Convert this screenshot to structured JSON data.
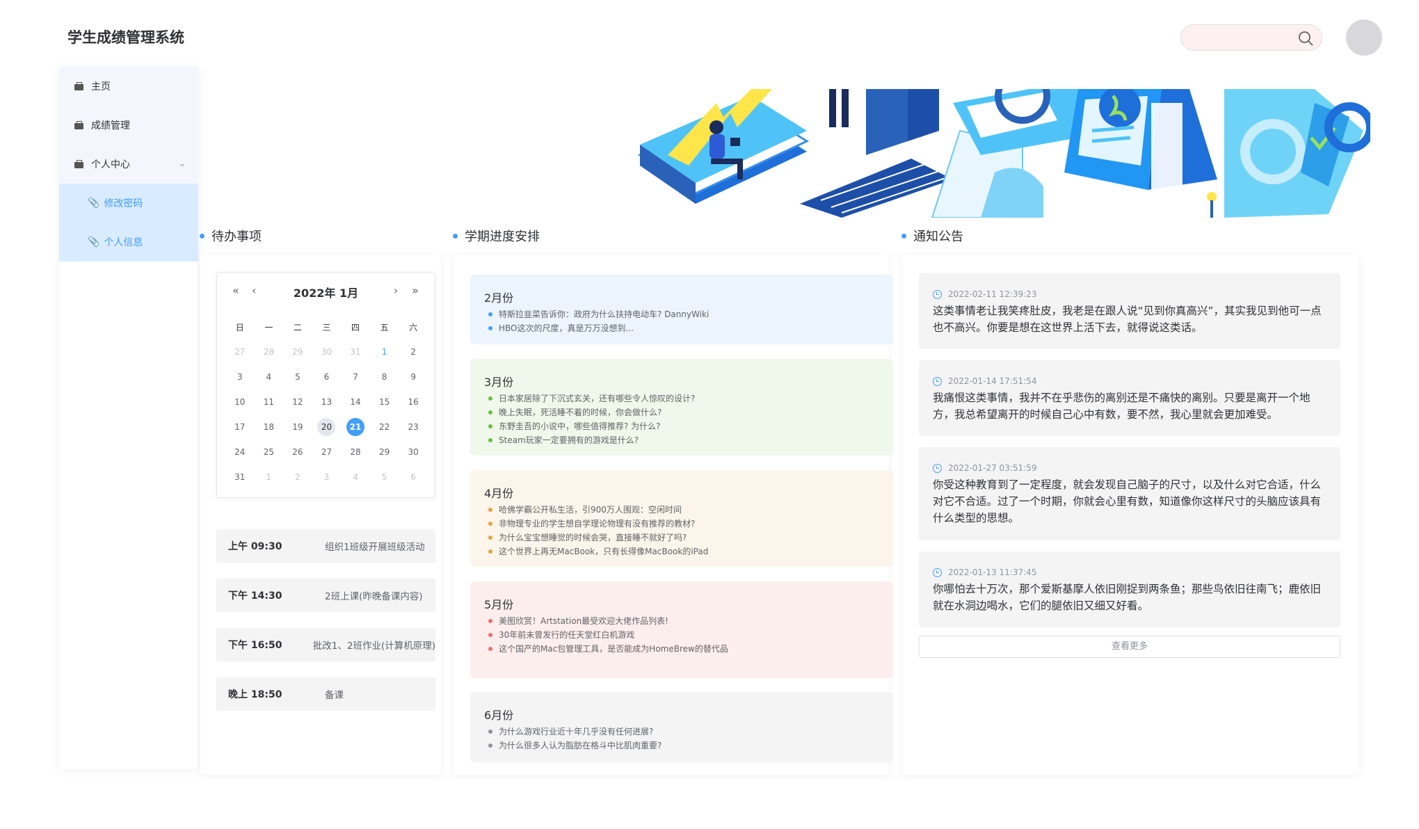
{
  "header": {
    "app_title": "学生成绩管理系统",
    "search_placeholder": ""
  },
  "sidebar": {
    "items": [
      {
        "label": "主页"
      },
      {
        "label": "成绩管理"
      },
      {
        "label": "个人中心"
      }
    ],
    "sub_items": [
      {
        "label": "修改密码"
      },
      {
        "label": "个人信息"
      }
    ]
  },
  "sections": {
    "todo_title": "待办事项",
    "semester_title": "学期进度安排",
    "notice_title": "通知公告"
  },
  "calendar": {
    "title": "2022年  1月",
    "nav": {
      "prev_year": "«",
      "prev_month": "‹",
      "next_month": "›",
      "next_year": "»"
    },
    "weekdays": [
      "日",
      "一",
      "二",
      "三",
      "四",
      "五",
      "六"
    ],
    "weeks": [
      [
        "27",
        "28",
        "29",
        "30",
        "31",
        "1",
        "2"
      ],
      [
        "3",
        "4",
        "5",
        "6",
        "7",
        "8",
        "9"
      ],
      [
        "10",
        "11",
        "12",
        "13",
        "14",
        "15",
        "16"
      ],
      [
        "17",
        "18",
        "19",
        "20",
        "21",
        "22",
        "23"
      ],
      [
        "24",
        "25",
        "26",
        "27",
        "28",
        "29",
        "30"
      ],
      [
        "31",
        "1",
        "2",
        "3",
        "4",
        "5",
        "6"
      ]
    ],
    "today": "20",
    "selected": "21"
  },
  "todos": [
    {
      "time": "上午 09:30",
      "text": "组织1班级开展班级活动"
    },
    {
      "time": "下午 14:30",
      "text": "2班上课(昨晚备课内容)"
    },
    {
      "time": "下午 16:50",
      "text": "批改1、2班作业(计算机原理)"
    },
    {
      "time": "晚上 18:50",
      "text": "备课"
    }
  ],
  "semester": [
    {
      "month": "2月份",
      "bg": "#ecf4fe",
      "dot": "#409eff",
      "items": [
        "特斯拉韭菜告诉你：政府为什么扶持电动车? DannyWiki",
        "HBO这次的尺度，真是万万没想到..."
      ]
    },
    {
      "month": "3月份",
      "bg": "#f0f8ec",
      "dot": "#67c23a",
      "items": [
        "日本家居除了下沉式玄关，还有哪些令人惊叹的设计?",
        "晚上失眠，死活睡不着的时候，你会做什么?",
        "东野圭吾的小说中，哪些值得推荐? 为什么?",
        "Steam玩家一定要拥有的游戏是什么?"
      ]
    },
    {
      "month": "4月份",
      "bg": "#fcf5eb",
      "dot": "#e6a23c",
      "items": [
        "哈佛学霸公开私生活，引900万人围观：空闲时间",
        "非物理专业的学生想自学理论物理有没有推荐的教材?",
        "为什么宝宝想睡觉的时候会哭，直接睡不就好了吗?",
        "这个世界上再无MacBook，只有长得像MacBook的iPad"
      ]
    },
    {
      "month": "5月份",
      "bg": "#fdeeee",
      "dot": "#f56c6c",
      "items": [
        "美图欣赏！Artstation最受欢迎大佬作品列表!",
        "30年前未曾发行的任天堂红白机游戏",
        "这个国产的Mac包管理工具，是否能成为HomeBrew的替代品"
      ]
    },
    {
      "month": "6月份",
      "bg": "#f4f4f5",
      "dot": "#909399",
      "items": [
        "为什么游戏行业近十年几乎没有任何进展?",
        "为什么很多人认为脂肪在格斗中比肌肉重要?"
      ]
    }
  ],
  "notices": [
    {
      "time": "2022-02-11 12:39:23",
      "text": "这类事情老让我笑疼肚皮，我老是在跟人说“见到你真高兴”，其实我见到他可一点也不高兴。你要是想在这世界上活下去，就得说这类话。"
    },
    {
      "time": "2022-01-14 17:51:54",
      "text": "我痛恨这类事情，我并不在乎悲伤的离别还是不痛快的离别。只要是离开一个地方，我总希望离开的时候自己心中有数，要不然，我心里就会更加难受。"
    },
    {
      "time": "2022-01-27 03:51:59",
      "text": "你受这种教育到了一定程度，就会发现自己脑子的尺寸，以及什么对它合适，什么对它不合适。过了一个时期，你就会心里有数，知道像你这样尺寸的头脑应该具有什么类型的思想。"
    },
    {
      "time": "2022-01-13 11:37:45",
      "text": "你哪怕去十万次，那个爱斯基摩人依旧刚捉到两条鱼；那些鸟依旧往南飞；鹿依旧就在水洞边喝水，它们的腿依旧又细又好看。"
    }
  ],
  "more_label": "查看更多",
  "colors": {
    "accent": "#409eff"
  }
}
